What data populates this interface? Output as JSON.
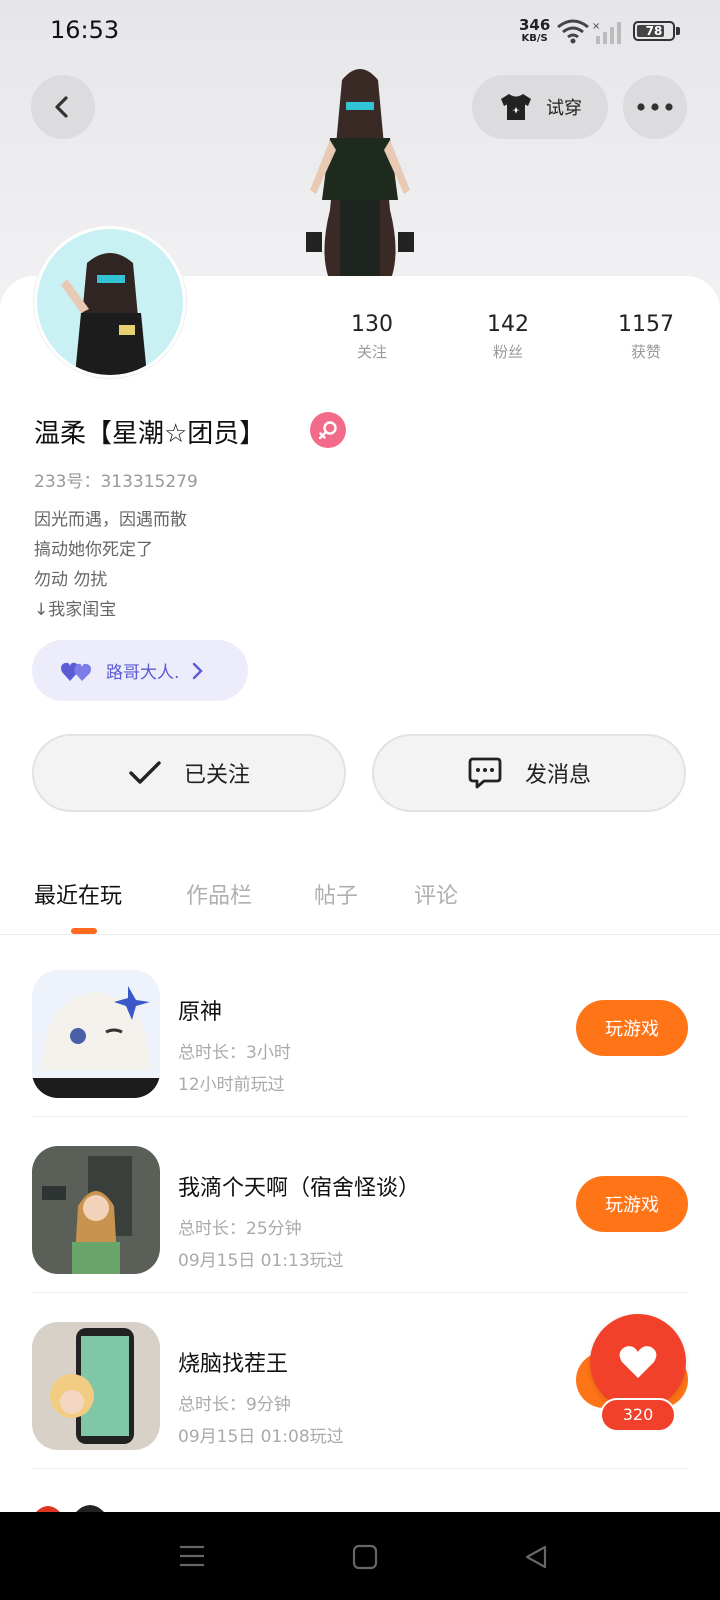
{
  "status_bar": {
    "time": "16:53",
    "speed_value": "346",
    "speed_unit": "KB/S",
    "battery": "78",
    "battery_level": 0.78
  },
  "header": {
    "try_on_label": "试穿"
  },
  "stats": [
    {
      "value": "130",
      "label": "关注"
    },
    {
      "value": "142",
      "label": "粉丝"
    },
    {
      "value": "1157",
      "label": "获赞"
    }
  ],
  "profile": {
    "name": "温柔【星潮☆团员】",
    "id_label": "233号：313315279",
    "bio": [
      "因光而遇，因遇而散",
      "搞动她你死定了",
      "勿动  勿扰",
      "↓我家闺宝"
    ],
    "tag_label": "路哥大人."
  },
  "actions": {
    "follow_label": "已关注",
    "message_label": "发消息"
  },
  "tabs": [
    "最近在玩",
    "作品栏",
    "帖子",
    "评论"
  ],
  "games": [
    {
      "title": "原神",
      "total": "总时长：3小时",
      "last": "12小时前玩过",
      "button": "玩游戏"
    },
    {
      "title": "我滴个天啊（宿舍怪谈）",
      "total": "总时长：25分钟",
      "last": "09月15日 01:13玩过",
      "button": "玩游戏"
    },
    {
      "title": "烧脑找茬王",
      "total": "总时长：9分钟",
      "last": "09月15日 01:08玩过",
      "button": "玩游戏"
    }
  ],
  "like": {
    "count": "320"
  },
  "icon_names": [
    "back-arrow-icon",
    "shirt-icon",
    "more-icon",
    "heart-icon",
    "check-icon",
    "chat-icon",
    "menu-icon",
    "home-icon",
    "back-nav-icon"
  ],
  "colors": {
    "accent_orange": "#ff7417",
    "like_red": "#f2412a",
    "tag_purple": "#5b5bd6",
    "gender_pink": "#f26b8a"
  }
}
